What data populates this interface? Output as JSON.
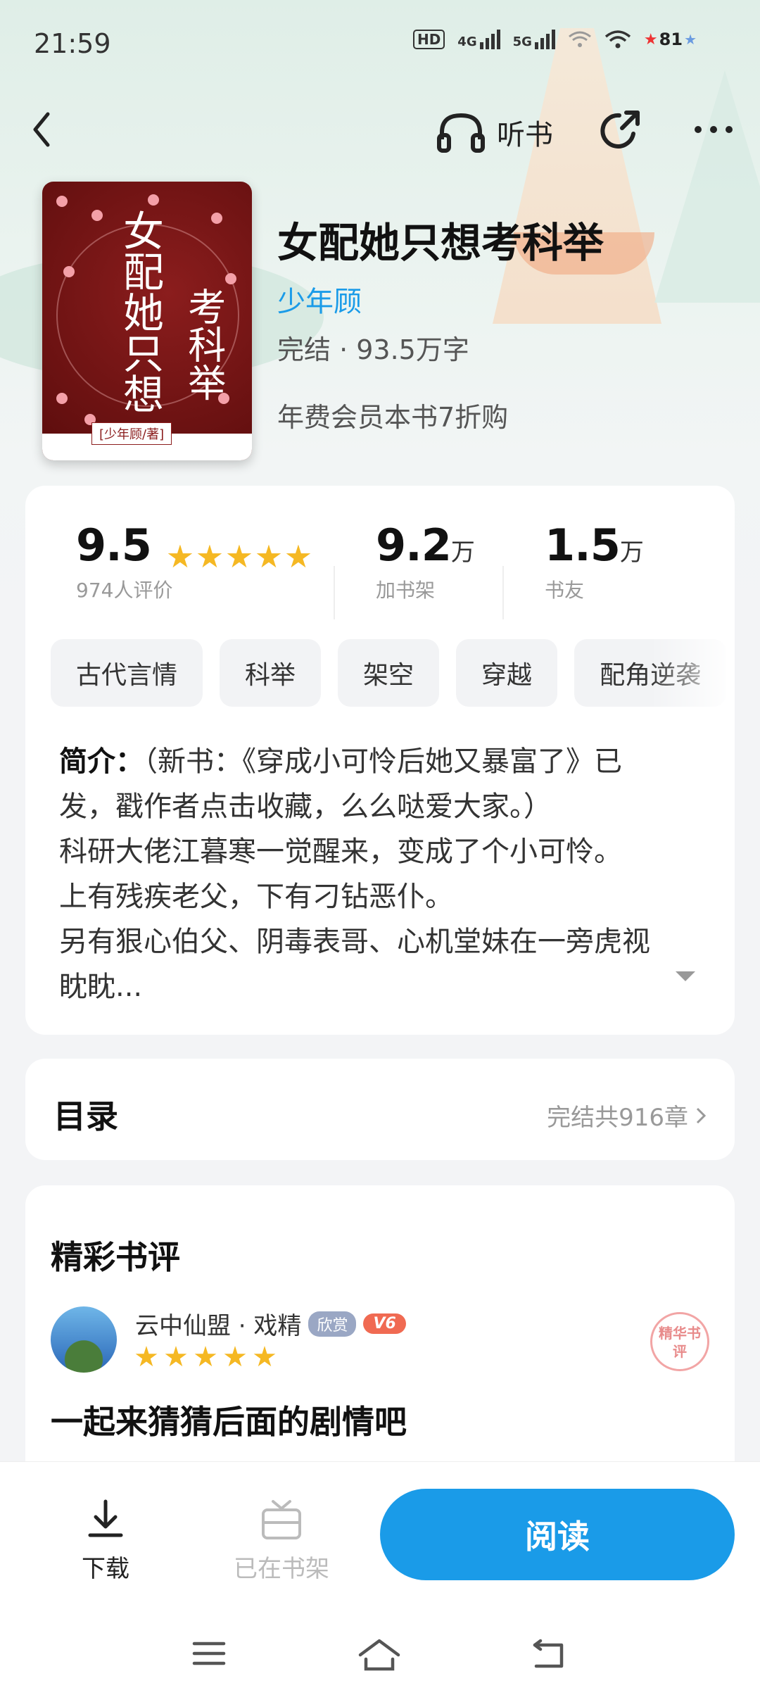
{
  "status_bar": {
    "time": "21:59",
    "battery": "81",
    "network": [
      "HD",
      "4G",
      "5G"
    ]
  },
  "header": {
    "listen_label": "听书"
  },
  "book": {
    "title": "女配她只想考科举",
    "author": "少年顾",
    "status": "完结 · 93.5万字",
    "vip_offer": "年费会员本书7折购",
    "cover": {
      "title_line1": "女配她只想",
      "title_line2": "考科举",
      "author_tag": "[少年顾/著]"
    }
  },
  "stats": {
    "rating": "9.5",
    "rating_stars": 5,
    "rating_count": "974人评价",
    "shelf_num": "9.2",
    "shelf_unit": "万",
    "shelf_label": "加书架",
    "friends_num": "1.5",
    "friends_unit": "万",
    "friends_label": "书友"
  },
  "tags": [
    "古代言情",
    "科举",
    "架空",
    "穿越",
    "配角逆袭"
  ],
  "intro": {
    "label": "简介：",
    "lines": [
      "（新书：《穿成小可怜后她又暴富了》已",
      "发，戳作者点击收藏，么么哒爱大家。）",
      "科研大佬江暮寒一觉醒来，变成了个小可怜。",
      "上有残疾老父，下有刁钻恶仆。",
      "另有狠心伯父、阴毒表哥、心机堂妹在一旁虎视",
      "眈眈..."
    ]
  },
  "toc": {
    "title": "目录",
    "info": "完结共916章"
  },
  "reviews": {
    "title": "精彩书评",
    "items": [
      {
        "user": "云中仙盟 · 戏精",
        "badge": "欣赏",
        "level": "V6",
        "stars": 5,
        "seal": "精华书评",
        "text": "一起来猜猜后面的剧情吧"
      }
    ]
  },
  "bottom": {
    "download": "下载",
    "on_shelf": "已在书架",
    "read": "阅读"
  },
  "colors": {
    "accent": "#1a9be8",
    "star": "#f5b823"
  }
}
